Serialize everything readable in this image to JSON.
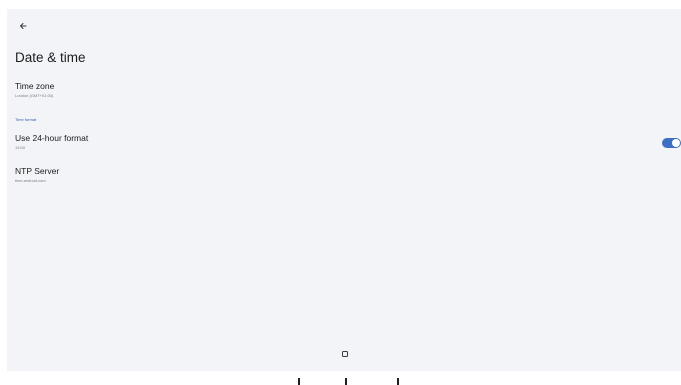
{
  "page": {
    "title": "Date & time"
  },
  "settings": {
    "time_zone": {
      "title": "Time zone",
      "summary": "London (GMT+01:00)"
    },
    "section_header": "Time format",
    "use_24_hour": {
      "title": "Use 24-hour format",
      "summary": "13:00",
      "enabled": true
    },
    "ntp_server": {
      "title": "NTP Server",
      "summary": "time.android.com"
    }
  },
  "icons": {
    "back": "back-arrow-icon",
    "home": "home-square-icon"
  },
  "colors": {
    "background": "#f3f4f7",
    "accent": "#3f6fc4",
    "section_header": "#2f5fa8",
    "text_primary": "#1c1c1e",
    "text_secondary": "#7a7a80"
  }
}
